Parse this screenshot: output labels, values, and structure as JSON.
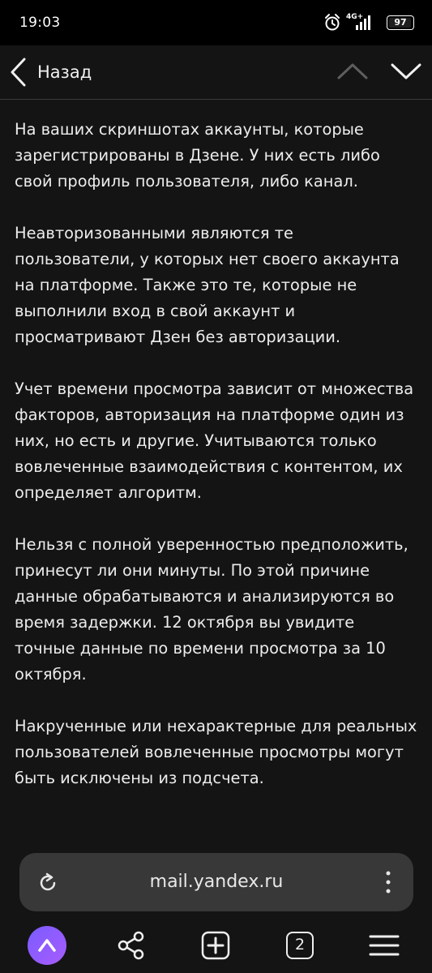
{
  "status_bar": {
    "time": "19:03",
    "network": "4G+",
    "battery": "97",
    "battery_level": 0.97,
    "icons": [
      "alarm-icon",
      "signal-icon",
      "battery-icon"
    ]
  },
  "nav": {
    "back_label": "Назад",
    "icons": [
      "chevron-left-icon",
      "chevron-up-icon",
      "chevron-down-icon"
    ]
  },
  "article": {
    "paragraphs": [
      "На ваших скриншотах аккаунты, которые зарегистрированы в Дзене. У них есть либо свой профиль пользователя, либо канал.",
      "Неавторизованными являются те пользователи, у которых нет своего аккаунта на платформе. Также это те, которые не выполнили вход в свой аккаунт и просматривают Дзен без авторизации.",
      "Учет времени просмотра зависит от множества факторов, авторизация на платформе один из них, но есть и другие. Учитываются только вовлеченные взаимодействия с контентом, их определяет алгоритм.",
      "Нельзя с полной уверенностью предположить, принесут ли они минуты. По этой причине данные обрабатываются и анализируются во время задержки. 12 октября вы увидите точные данные по времени просмотра за 10 октября.",
      "Накрученные или нехарактерные для реальных пользователей вовлеченные просмотры могут быть исключены из подсчета."
    ]
  },
  "browser": {
    "url": "mail.yandex.ru",
    "tabs_count": "2",
    "toolbar_icons": [
      "alice-icon",
      "share-icon",
      "new-tab-icon",
      "tabs-icon",
      "menu-icon"
    ]
  },
  "colors": {
    "background": "#141414",
    "text": "#ececec",
    "url_bar": "#383838",
    "alice_accent": "#8a5cff"
  }
}
